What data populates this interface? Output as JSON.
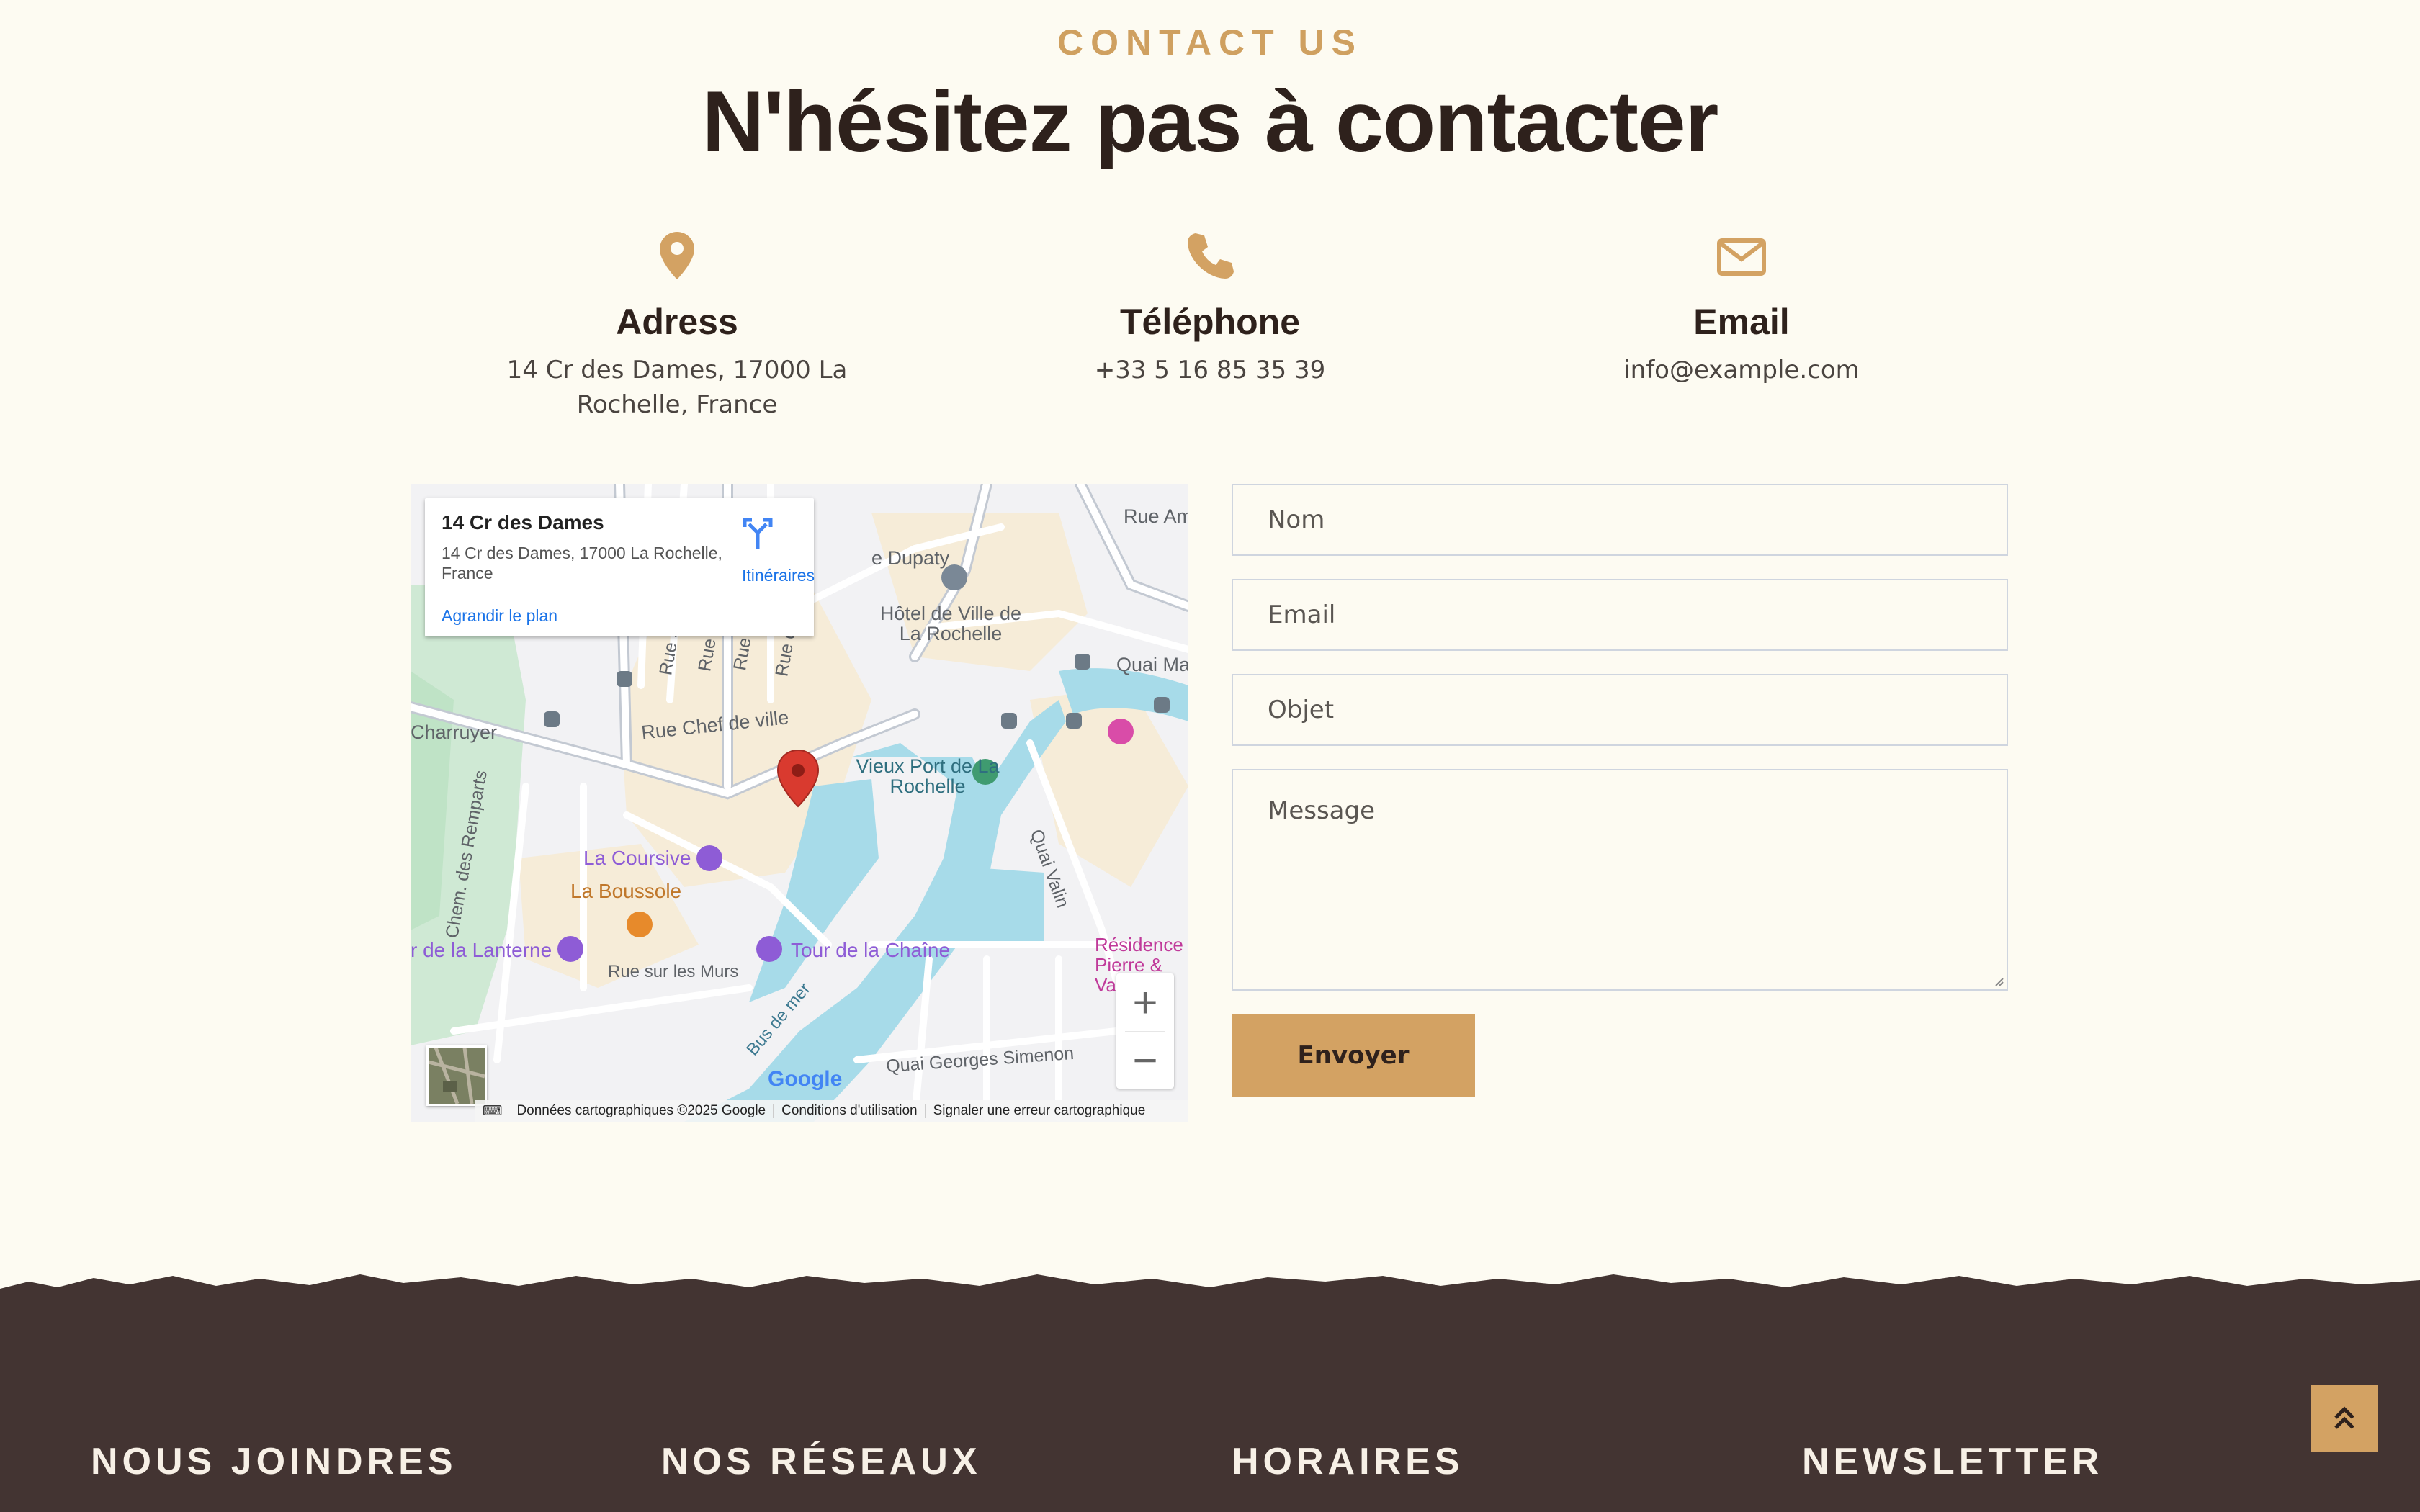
{
  "section": {
    "eyebrow": "CONTACT US",
    "heading": "N'hésitez pas à contacter"
  },
  "info": {
    "address": {
      "icon": "map-pin-icon",
      "title": "Adress",
      "text": "14 Cr des Dames, 17000 La Rochelle, France"
    },
    "phone": {
      "icon": "phone-icon",
      "title": "Téléphone",
      "text": "+33 5 16 85 35 39"
    },
    "email": {
      "icon": "envelope-icon",
      "title": "Email",
      "text": "info@example.com"
    }
  },
  "map": {
    "card": {
      "title": "14 Cr des Dames",
      "address": "14 Cr des Dames, 17000 La Rochelle, France",
      "enlarge_link": "Agrandir le plan",
      "directions": "Itinéraires"
    },
    "labels": {
      "hotel_de_ville": "Hôtel de Ville de La Rochelle",
      "vieux_port": "Vieux Port de La Rochelle",
      "la_coursive": "La Coursive",
      "la_boussole": "La Boussole",
      "tour_lanterne": "r de la Lanterne",
      "tour_chaine": "Tour de la Chaîne",
      "rue_chef_de_ville": "Rue Chef de ville",
      "charruyer": "Charruyer",
      "chem_remparts": "Chem. des Remparts",
      "rue_sur_les_murs": "Rue sur les Murs",
      "bus_de_mer": "Bus de mer",
      "quai_valin": "Quai Valin",
      "quai_georges_simenon": "Quai Georges Simenon",
      "quai_ma": "Quai Ma",
      "rue_am": "Rue Am",
      "dupaty": "e Dupaty",
      "residence": "Résidence Pierre & Va",
      "rue_sa": "Rue Sa",
      "rue_de_l": "Rue de l",
      "rue_adr": "Rue Adr",
      "rue_d": "Rue d"
    },
    "zoom_in": "+",
    "zoom_out": "−",
    "google": "Google",
    "attribution": {
      "data": "Données cartographiques ©2025 Google",
      "terms": "Conditions d'utilisation",
      "report": "Signaler une erreur cartographique"
    }
  },
  "form": {
    "name_placeholder": "Nom",
    "email_placeholder": "Email",
    "subject_placeholder": "Objet",
    "message_placeholder": "Message",
    "submit": "Envoyer"
  },
  "footer": {
    "col1": "NOUS JOINDRES",
    "col2": "NOS RÉSEAUX",
    "col3": "HORAIRES",
    "col4": "NEWSLETTER",
    "scroll_top_icon": "double-chevron-up-icon"
  },
  "colors": {
    "background": "#fdfbf2",
    "accent": "#d3a263",
    "heading": "#2e211c",
    "footer": "#433432"
  }
}
